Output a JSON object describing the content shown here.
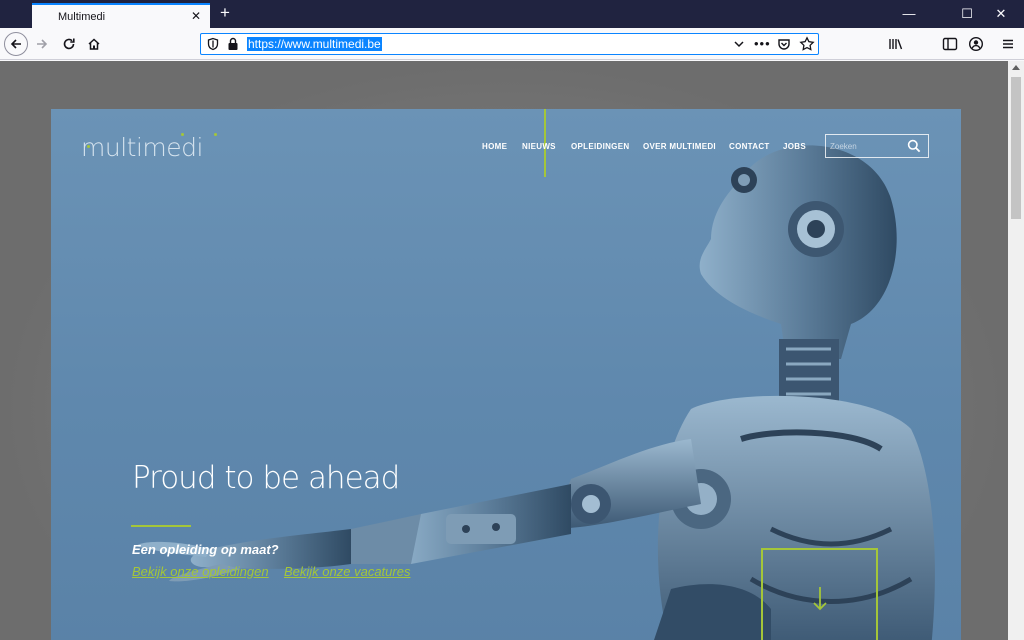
{
  "browser": {
    "tab_title": "Multimedi",
    "tab_close": "✕",
    "new_tab": "+",
    "url": "https://www.multimedi.be",
    "more_actions": "•••",
    "window": {
      "minimize": "—",
      "maximize": "☐",
      "close": "✕"
    }
  },
  "site": {
    "logo": "multimedi",
    "nav": [
      "HOME",
      "NIEUWS",
      "OPLEIDINGEN",
      "OVER MULTIMEDI",
      "CONTACT",
      "JOBS"
    ],
    "active_nav": "HOME",
    "search_placeholder": "Zoeken",
    "headline": "Proud to be ahead",
    "subheadline": "Een opleiding op maat?",
    "links": [
      "Bekijk onze opleidingen",
      "Bekijk onze vacatures"
    ],
    "accent_color": "#a4c639"
  }
}
